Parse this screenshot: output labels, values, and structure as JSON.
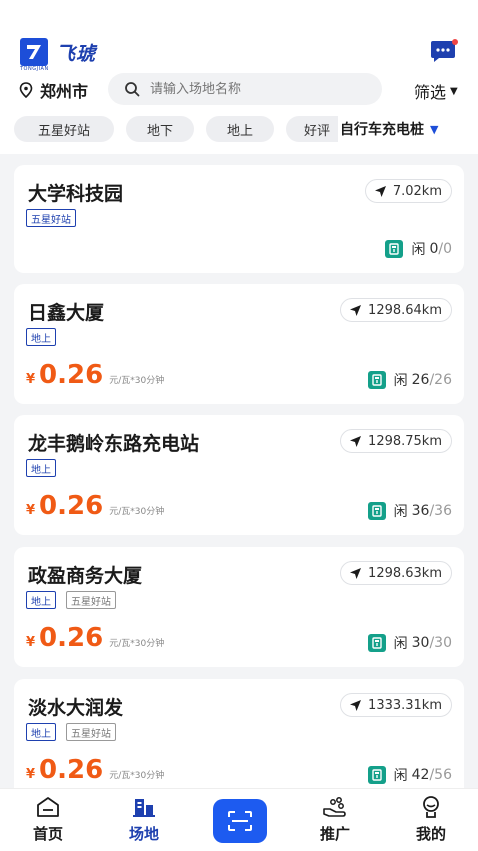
{
  "app": {
    "logo_text": "飞琥",
    "logo_sub": "TONGJIAN"
  },
  "header": {
    "city": "郑州市",
    "search_placeholder": "请输入场地名称",
    "filter_label": "筛选"
  },
  "chips": [
    "五星好站",
    "地下",
    "地上",
    "好评"
  ],
  "chip_more": "自行车充电桩",
  "colors": {
    "accent": "#1d5bf0",
    "price": "#f05a15",
    "status_icon": "#14a08a"
  },
  "stations": [
    {
      "name": "大学科技园",
      "distance": "7.02km",
      "tags": [
        "五星好站"
      ],
      "price": null,
      "price_unit": null,
      "status_label": "闲",
      "free": "0",
      "total": "0"
    },
    {
      "name": "日鑫大厦",
      "distance": "1298.64km",
      "tags": [
        "地上"
      ],
      "price": "0.26",
      "price_unit": "元/瓦*30分钟",
      "status_label": "闲",
      "free": "26",
      "total": "26"
    },
    {
      "name": "龙丰鹅岭东路充电站",
      "distance": "1298.75km",
      "tags": [
        "地上"
      ],
      "price": "0.26",
      "price_unit": "元/瓦*30分钟",
      "status_label": "闲",
      "free": "36",
      "total": "36"
    },
    {
      "name": "政盈商务大厦",
      "distance": "1298.63km",
      "tags": [
        "地上",
        "五星好站"
      ],
      "price": "0.26",
      "price_unit": "元/瓦*30分钟",
      "status_label": "闲",
      "free": "30",
      "total": "30"
    },
    {
      "name": "淡水大润发",
      "distance": "1333.31km",
      "tags": [
        "地上",
        "五星好站"
      ],
      "price": "0.26",
      "price_unit": "元/瓦*30分钟",
      "status_label": "闲",
      "free": "42",
      "total": "56"
    }
  ],
  "currency": "¥",
  "tabbar": {
    "home": "首页",
    "venue": "场地",
    "promote": "推广",
    "mine": "我的"
  }
}
